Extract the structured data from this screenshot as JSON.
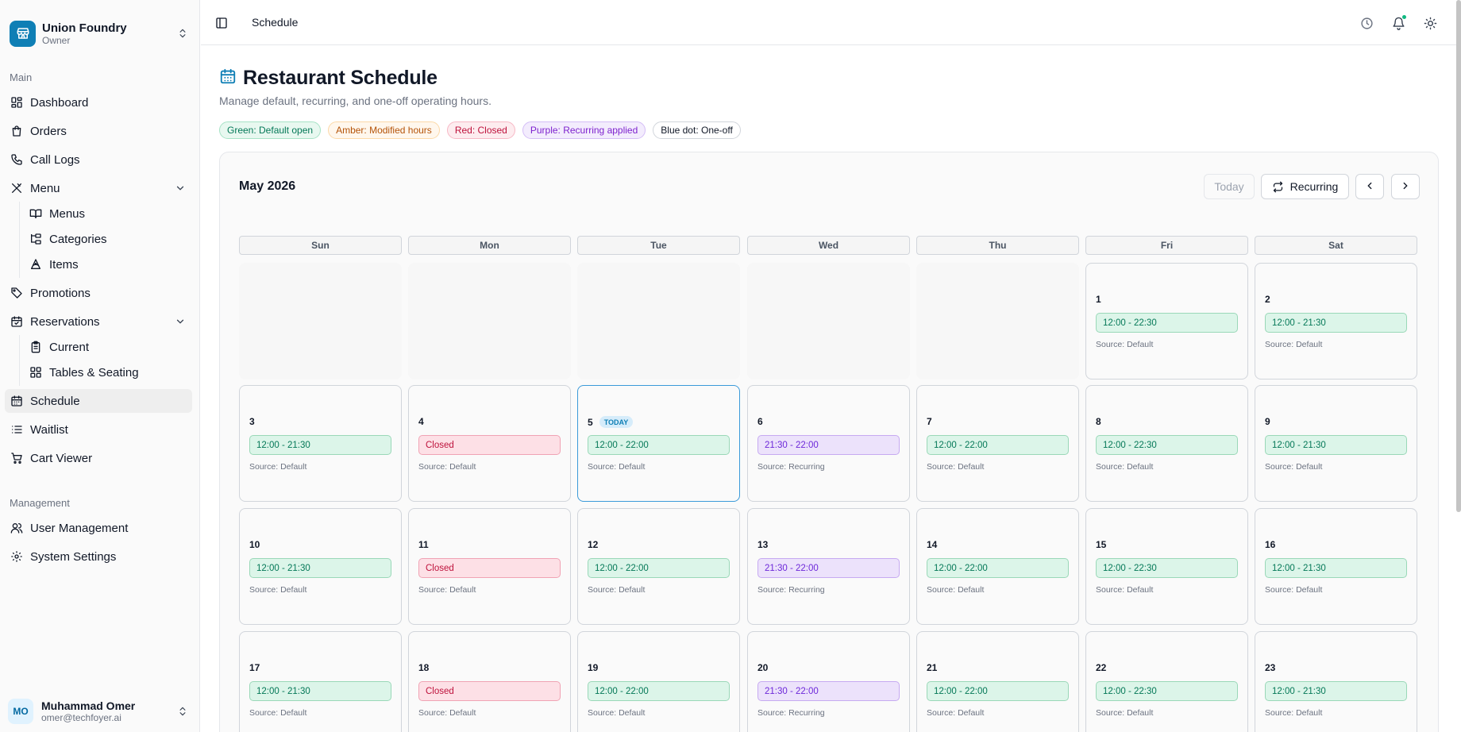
{
  "sidebar": {
    "org": {
      "name": "Union Foundry",
      "role": "Owner"
    },
    "sections": {
      "main": "Main",
      "management": "Management"
    },
    "items": {
      "dashboard": "Dashboard",
      "orders": "Orders",
      "call_logs": "Call Logs",
      "menu": "Menu",
      "menus": "Menus",
      "categories": "Categories",
      "items": "Items",
      "promotions": "Promotions",
      "reservations": "Reservations",
      "current": "Current",
      "tables_seating": "Tables & Seating",
      "schedule": "Schedule",
      "waitlist": "Waitlist",
      "cart_viewer": "Cart Viewer",
      "user_management": "User Management",
      "system_settings": "System Settings"
    },
    "user": {
      "initials": "MO",
      "name": "Muhammad Omer",
      "email": "omer@techfoyer.ai"
    }
  },
  "topbar": {
    "breadcrumb": "Schedule"
  },
  "page": {
    "title": "Restaurant Schedule",
    "subtitle": "Manage default, recurring, and one-off operating hours.",
    "legend": {
      "green": "Green: Default open",
      "amber": "Amber: Modified hours",
      "red": "Red: Closed",
      "purple": "Purple: Recurring applied",
      "blue": "Blue dot: One-off"
    }
  },
  "calendar": {
    "month_label": "May 2026",
    "today_button": "Today",
    "recurring_button": "Recurring",
    "today_tag": "TODAY",
    "weekdays": [
      "Sun",
      "Mon",
      "Tue",
      "Wed",
      "Thu",
      "Fri",
      "Sat"
    ],
    "days": [
      {
        "day": "1",
        "hours": "12:00 - 22:30",
        "status": "default",
        "source": "Source: Default"
      },
      {
        "day": "2",
        "hours": "12:00 - 21:30",
        "status": "default",
        "source": "Source: Default"
      },
      {
        "day": "3",
        "hours": "12:00 - 21:30",
        "status": "default",
        "source": "Source: Default"
      },
      {
        "day": "4",
        "hours": "Closed",
        "status": "closed",
        "source": "Source: Default"
      },
      {
        "day": "5",
        "hours": "12:00 - 22:00",
        "status": "default",
        "source": "Source: Default",
        "today": true
      },
      {
        "day": "6",
        "hours": "21:30 - 22:00",
        "status": "recurring",
        "source": "Source: Recurring"
      },
      {
        "day": "7",
        "hours": "12:00 - 22:00",
        "status": "default",
        "source": "Source: Default"
      },
      {
        "day": "8",
        "hours": "12:00 - 22:30",
        "status": "default",
        "source": "Source: Default"
      },
      {
        "day": "9",
        "hours": "12:00 - 21:30",
        "status": "default",
        "source": "Source: Default"
      },
      {
        "day": "10",
        "hours": "12:00 - 21:30",
        "status": "default",
        "source": "Source: Default"
      },
      {
        "day": "11",
        "hours": "Closed",
        "status": "closed",
        "source": "Source: Default"
      },
      {
        "day": "12",
        "hours": "12:00 - 22:00",
        "status": "default",
        "source": "Source: Default"
      },
      {
        "day": "13",
        "hours": "21:30 - 22:00",
        "status": "recurring",
        "source": "Source: Recurring"
      },
      {
        "day": "14",
        "hours": "12:00 - 22:00",
        "status": "default",
        "source": "Source: Default"
      },
      {
        "day": "15",
        "hours": "12:00 - 22:30",
        "status": "default",
        "source": "Source: Default"
      },
      {
        "day": "16",
        "hours": "12:00 - 21:30",
        "status": "default",
        "source": "Source: Default"
      },
      {
        "day": "17",
        "hours": "12:00 - 21:30",
        "status": "default",
        "source": "Source: Default"
      },
      {
        "day": "18",
        "hours": "Closed",
        "status": "closed",
        "source": "Source: Default"
      },
      {
        "day": "19",
        "hours": "12:00 - 22:00",
        "status": "default",
        "source": "Source: Default"
      },
      {
        "day": "20",
        "hours": "21:30 - 22:00",
        "status": "recurring",
        "source": "Source: Recurring"
      },
      {
        "day": "21",
        "hours": "12:00 - 22:00",
        "status": "default",
        "source": "Source: Default"
      },
      {
        "day": "22",
        "hours": "12:00 - 22:30",
        "status": "default",
        "source": "Source: Default"
      },
      {
        "day": "23",
        "hours": "12:00 - 21:30",
        "status": "default",
        "source": "Source: Default"
      }
    ]
  },
  "colors": {
    "brand": "#0f7fb5",
    "default": "#047857",
    "closed": "#be123c",
    "recurring": "#6d28d9"
  }
}
